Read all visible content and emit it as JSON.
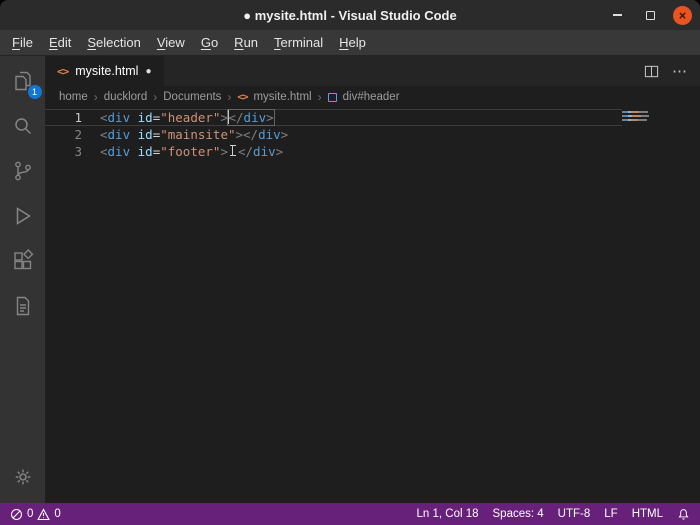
{
  "window": {
    "title": "● mysite.html - Visual Studio Code"
  },
  "menu_bar": {
    "items": [
      "File",
      "Edit",
      "Selection",
      "View",
      "Go",
      "Run",
      "Terminal",
      "Help"
    ]
  },
  "activity_bar": {
    "explorer_badge": "1"
  },
  "tab_bar": {
    "tabs": [
      {
        "label": "mysite.html",
        "modified": true
      }
    ]
  },
  "icons": {
    "html_file": "<>",
    "modified_dot": "●",
    "breadcrumb_chevron": "›",
    "ellipsis": "⋯"
  },
  "breadcrumbs": {
    "items": [
      "home",
      "ducklord",
      "Documents",
      "mysite.html",
      "div#header"
    ]
  },
  "editor": {
    "lines": [
      {
        "number": "1",
        "current": true,
        "tokens": [
          {
            "t": "<",
            "c": "pun"
          },
          {
            "t": "div",
            "c": "tag"
          },
          {
            "t": " ",
            "c": "plain"
          },
          {
            "t": "id",
            "c": "attr"
          },
          {
            "t": "=",
            "c": "plain"
          },
          {
            "t": "\"header\"",
            "c": "str"
          },
          {
            "t": ">",
            "c": "pun"
          },
          {
            "t": "",
            "c": "caret"
          },
          {
            "c": "match-box",
            "group": [
              {
                "t": "</",
                "c": "pun"
              },
              {
                "t": "div",
                "c": "tag"
              },
              {
                "t": ">",
                "c": "pun"
              }
            ]
          }
        ]
      },
      {
        "number": "2",
        "current": false,
        "tokens": [
          {
            "t": "<",
            "c": "pun"
          },
          {
            "t": "div",
            "c": "tag"
          },
          {
            "t": " ",
            "c": "plain"
          },
          {
            "t": "id",
            "c": "attr"
          },
          {
            "t": "=",
            "c": "plain"
          },
          {
            "t": "\"mainsite\"",
            "c": "str"
          },
          {
            "t": ">",
            "c": "pun"
          },
          {
            "t": "</",
            "c": "pun"
          },
          {
            "t": "div",
            "c": "tag"
          },
          {
            "t": ">",
            "c": "pun"
          }
        ]
      },
      {
        "number": "3",
        "current": false,
        "tokens": [
          {
            "t": "<",
            "c": "pun"
          },
          {
            "t": "div",
            "c": "tag"
          },
          {
            "t": " ",
            "c": "plain"
          },
          {
            "t": "id",
            "c": "attr"
          },
          {
            "t": "=",
            "c": "plain"
          },
          {
            "t": "\"footer\"",
            "c": "str"
          },
          {
            "t": ">",
            "c": "pun"
          },
          {
            "t": "",
            "c": "ibeam"
          },
          {
            "t": "</",
            "c": "pun"
          },
          {
            "t": "div",
            "c": "tag"
          },
          {
            "t": ">",
            "c": "pun"
          }
        ]
      }
    ]
  },
  "status_bar": {
    "errors": "0",
    "warnings": "0",
    "cursor_position": "Ln 1, Col 18",
    "indentation": "Spaces: 4",
    "encoding": "UTF-8",
    "eol": "LF",
    "language": "HTML"
  },
  "colors": {
    "status_bar": "#68217a",
    "badge": "#1277d3",
    "close_button": "#e95420",
    "html_icon": "#e8824a"
  }
}
